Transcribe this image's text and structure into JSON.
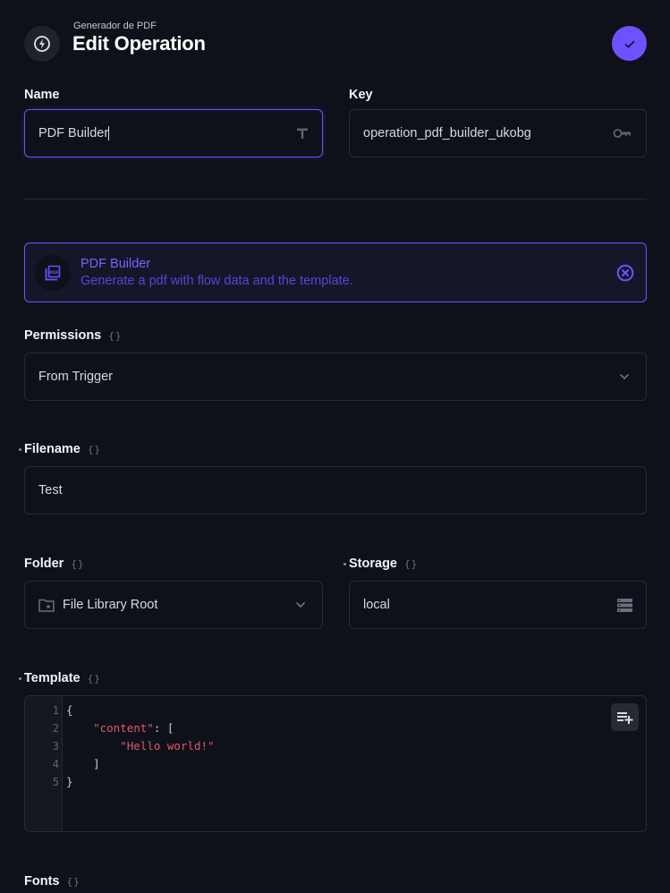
{
  "header": {
    "subtitle": "Generador de PDF",
    "title": "Edit Operation",
    "icon": "bolt-icon",
    "save_icon": "check-icon"
  },
  "fields": {
    "name": {
      "label": "Name",
      "value": "PDF Builder",
      "icon": "text-type-icon"
    },
    "key": {
      "label": "Key",
      "value": "operation_pdf_builder_ukobg",
      "icon": "key-icon"
    }
  },
  "operation": {
    "title": "PDF Builder",
    "description": "Generate a pdf with flow data and the template.",
    "icon": "pdf-icon",
    "close_icon": "cancel-circle-icon"
  },
  "permissions": {
    "label": "Permissions",
    "value": "From Trigger",
    "icon": "chevron-down-icon"
  },
  "filename": {
    "label": "Filename",
    "value": "Test",
    "required": true
  },
  "folder": {
    "label": "Folder",
    "value": "File Library Root",
    "icon": "folder-special-icon"
  },
  "storage": {
    "label": "Storage",
    "value": "local",
    "required": true,
    "icon": "storage-icon"
  },
  "template": {
    "label": "Template",
    "required": true,
    "line_numbers": [
      "1",
      "2",
      "3",
      "4",
      "5"
    ],
    "lines": [
      {
        "indent": "",
        "str": "",
        "text": "{"
      },
      {
        "indent": "    ",
        "str": "\"content\"",
        "text": ": ["
      },
      {
        "indent": "        ",
        "str": "\"Hello world!\"",
        "text": ""
      },
      {
        "indent": "    ",
        "str": "",
        "text": "]"
      },
      {
        "indent": "",
        "str": "",
        "text": "}"
      }
    ],
    "button_icon": "playlist-add-icon"
  },
  "fonts": {
    "label": "Fonts"
  },
  "raw_toggle": "{}",
  "colors": {
    "background": "#0e1119",
    "accent": "#6f51ff",
    "string": "#e2596a"
  }
}
